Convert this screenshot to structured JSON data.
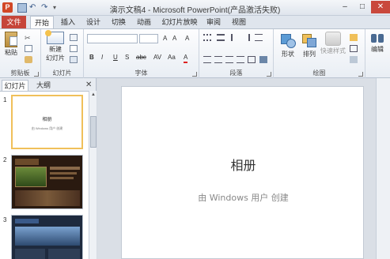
{
  "window": {
    "title": "演示文稿4 - Microsoft PowerPoint(产品激活失败)",
    "app_icon": "P",
    "minimize": "–",
    "maximize": "□",
    "close": "✕"
  },
  "qat": {
    "undo": "↶",
    "redo": "↷",
    "more": "▾"
  },
  "tabs": [
    "文件",
    "开始",
    "插入",
    "设计",
    "切换",
    "动画",
    "幻灯片放映",
    "审阅",
    "视图"
  ],
  "ribbon": {
    "groups": {
      "clipboard": "剪贴板",
      "slides": "幻灯片",
      "font": "字体",
      "paragraph": "段落",
      "drawing": "绘图",
      "editing": ""
    },
    "buttons": {
      "paste": "粘贴",
      "new_slide_1": "新建",
      "new_slide_2": "幻灯片",
      "shape": "形状",
      "arrange": "排列",
      "quick_styles": "快速样式",
      "editing": "编辑"
    },
    "font_tools": [
      "B",
      "I",
      "U",
      "S",
      "abc",
      "AV",
      "Aa",
      "A"
    ]
  },
  "panel": {
    "tabs": [
      "幻灯片",
      "大纲"
    ],
    "close": "✕",
    "slides": [
      {
        "num": "1",
        "title": "相册",
        "sub": "由 Windows 用户 创建"
      },
      {
        "num": "2"
      },
      {
        "num": "3"
      }
    ]
  },
  "slide": {
    "title": "相册",
    "subtitle": "由 Windows 用户 创建"
  },
  "colors": {
    "file_tab": "#c6453a",
    "selection": "#f0c05a"
  }
}
